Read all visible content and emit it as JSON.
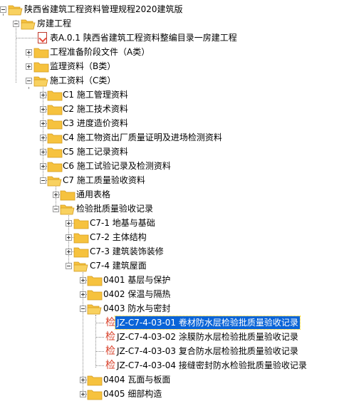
{
  "tree": {
    "root": "陕西省建筑工程资料管理规程2020建筑版",
    "n1": "房建工程",
    "n2": "表A.0.1 陕西省建筑工程资料整编目录一房建工程",
    "n3": "工程准备阶段文件（A类）",
    "n4": "监理资料（B类）",
    "n5": "施工资料（C类）",
    "n6": "C1 施工管理资料",
    "n7": "C2 施工技术资料",
    "n8": "C3 进度造价资料",
    "n9": "C4 施工物资出厂质量证明及进场检测资料",
    "n10": "C5 施工记录资料",
    "n11": "C6 施工试验记录及检测资料",
    "n12": "C7 施工质量验收资料",
    "n13": "通用表格",
    "n14": "检验批质量验收记录",
    "n15": "C7-1 地基与基础",
    "n16": "C7-2 主体结构",
    "n17": "C7-3 建筑装饰装修",
    "n18": "C7-4 建筑屋面",
    "n19": "0401 基层与保护",
    "n20": "0402 保温与隔热",
    "n21": "0403 防水与密封",
    "n22": "JZ-C7-4-03-01 卷材防水层检验批质量验收记录",
    "n23": "JZ-C7-4-03-02 涂膜防水层检验批质量验收记录",
    "n24": "JZ-C7-4-03-03 复合防水层检验批质量验收记录",
    "n25": "JZ-C7-4-03-04 接缝密封防水检验批质量验收记录",
    "n26": "0404 瓦面与板面",
    "n27": "0405 细部构造",
    "form_glyph": "检"
  },
  "colors": {
    "folder_fill": "#f6c23e",
    "folder_edge": "#d49a1c",
    "selection": "#0a64d8",
    "form_icon": "#d8402a"
  },
  "icons": {
    "folder": "folder-icon",
    "document": "document-icon",
    "form": "form-icon"
  }
}
